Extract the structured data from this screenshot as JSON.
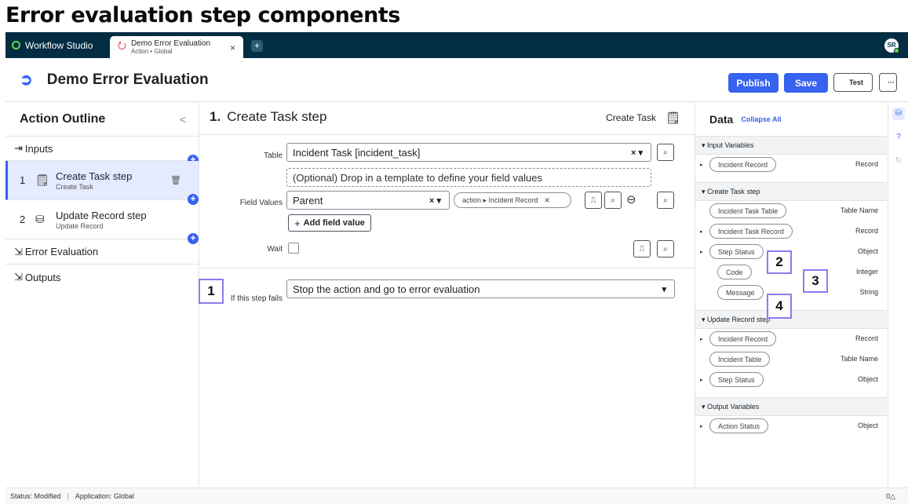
{
  "doc_title": "Error evaluation step components",
  "topbar": {
    "brand": "Workflow Studio",
    "tab_title": "Demo Error Evaluation",
    "tab_subtitle": "Action • Global",
    "tab_close": "×",
    "new_tab": "+",
    "avatar": "SR"
  },
  "header": {
    "title": "Demo Error Evaluation",
    "publish": "Publish",
    "save": "Save",
    "test": "Test",
    "more": "···"
  },
  "outline": {
    "title": "Action Outline",
    "collapse": "<",
    "inputs": "Inputs",
    "steps": [
      {
        "num": "1",
        "name": "Create Task step",
        "sub": "Create Task"
      },
      {
        "num": "2",
        "name": "Update Record step",
        "sub": "Update Record"
      }
    ],
    "error_evaluation": "Error Evaluation",
    "outputs": "Outputs"
  },
  "step": {
    "number": "1.",
    "title": "Create Task step",
    "type": "Create Task",
    "table_label": "Table",
    "table_value": "Incident Task [incident_task]",
    "template_placeholder": "(Optional) Drop in a template to define your field values",
    "field_values_label": "Field Values",
    "field_value": "Parent",
    "pill_action": "action ▸ Incident Record",
    "add_field_value": "Add field value",
    "wait_label": "Wait",
    "fail_label": "If this step fails",
    "fail_value": "Stop the action and go to error evaluation",
    "clear": "× ▾",
    "dropdown": "▾"
  },
  "data_panel": {
    "title": "Data",
    "collapse_all": "Collapse All",
    "sections": [
      {
        "name": "Input Variables",
        "rows": [
          {
            "label": "Incident Record",
            "type": "Record",
            "caret": true
          }
        ]
      },
      {
        "name": "Create Task step",
        "rows": [
          {
            "label": "Incident Task Table",
            "type": "Table Name",
            "caret": false
          },
          {
            "label": "Incident Task Record",
            "type": "Record",
            "caret": true
          },
          {
            "label": "Step Status",
            "type": "Object",
            "caret": true
          },
          {
            "label": "Code",
            "type": "Integer",
            "caret": false
          },
          {
            "label": "Message",
            "type": "String",
            "caret": false
          }
        ]
      },
      {
        "name": "Update Record step",
        "rows": [
          {
            "label": "Incident Record",
            "type": "Record",
            "caret": true
          },
          {
            "label": "Incident Table",
            "type": "Table Name",
            "caret": false
          },
          {
            "label": "Step Status",
            "type": "Object",
            "caret": true
          }
        ]
      },
      {
        "name": "Output Variables",
        "rows": [
          {
            "label": "Action Status",
            "type": "Object",
            "caret": true
          }
        ]
      }
    ]
  },
  "callouts": [
    "1",
    "2",
    "3",
    "4"
  ],
  "status": {
    "status": "Status: Modified",
    "application": "Application: Global",
    "right": "0△"
  },
  "colors": {
    "accent": "#3662f0",
    "topbar": "#032d42",
    "callout_border": "#8a7cf0"
  }
}
